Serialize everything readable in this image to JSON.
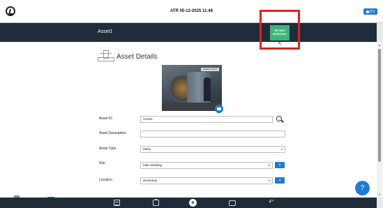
{
  "topbar": {
    "title": "ATR 05-12-2025 11:48",
    "user_label": "CO"
  },
  "header": {
    "asset_name": "Asset1",
    "green_button_line1": "SET1D0X",
    "green_button_line2": "BN7B2X321"
  },
  "section": {
    "title": "Asset Details",
    "photo_sign": "WINDING DEPOT"
  },
  "form": {
    "asset_id": {
      "label": "Asset ID",
      "value": "Asset1"
    },
    "asset_description": {
      "label": "Asset Description",
      "value": ""
    },
    "asset_type": {
      "label": "Asset Type",
      "value": "Motor"
    },
    "site": {
      "label": "Site",
      "value": "Main Building"
    },
    "location": {
      "label": "Location",
      "value": "Workshop"
    }
  },
  "buttons": {
    "plus": "+",
    "help": "?",
    "add": "+"
  },
  "colors": {
    "header_bg": "#1f2d3a",
    "accent_blue": "#1d7cd8",
    "green": "#3fb37a",
    "highlight_red": "#e02020"
  }
}
